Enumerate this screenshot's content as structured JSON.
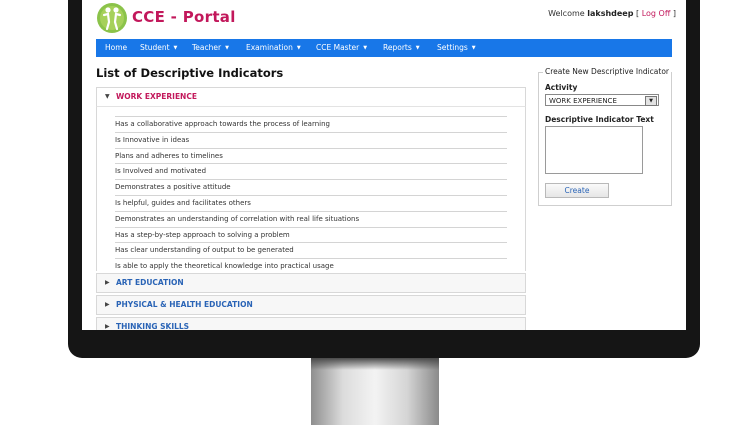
{
  "header": {
    "brand": "CCE - Portal",
    "welcome_prefix": "Welcome ",
    "username": "lakshdeep",
    "logoff_open": " [ ",
    "logoff_label": "Log Off",
    "logoff_close": " ]"
  },
  "nav": {
    "items": [
      {
        "label": "Home",
        "has_caret": false
      },
      {
        "label": "Student",
        "has_caret": true
      },
      {
        "label": "Teacher",
        "has_caret": true
      },
      {
        "label": "Examination",
        "has_caret": true
      },
      {
        "label": "CCE Master",
        "has_caret": true
      },
      {
        "label": "Reports",
        "has_caret": true
      },
      {
        "label": "Settings",
        "has_caret": true
      }
    ]
  },
  "main": {
    "title": "List of Descriptive Indicators",
    "sections": [
      {
        "title": "WORK EXPERIENCE",
        "expanded": true,
        "indicators": [
          "Has a collaborative approach towards the process of learning",
          "Is Innovative in ideas",
          "Plans and adheres to timelines",
          "Is Involved and motivated",
          "Demonstrates a positive attitude",
          "Is helpful, guides and facilitates others",
          "Demonstrates an understanding of correlation with real life situations",
          "Has a step-by-step approach to solving a problem",
          "Has clear understanding of output to be generated",
          "Is able to apply the theoretical knowledge into practical usage"
        ]
      },
      {
        "title": "ART EDUCATION",
        "expanded": false
      },
      {
        "title": "PHYSICAL & HEALTH EDUCATION",
        "expanded": false
      },
      {
        "title": "THINKING SKILLS",
        "expanded": false
      }
    ]
  },
  "side_panel": {
    "legend": "Create New Descriptive Indicator",
    "activity_label": "Activity",
    "activity_value": "WORK EXPERIENCE",
    "text_label": "Descriptive Indicator Text",
    "text_value": "",
    "create_label": "Create"
  },
  "icons": {
    "logo": "figure-logo-icon",
    "caret": "caret-down-icon",
    "expanded_arrow": "arrow-down-icon",
    "collapsed_arrow": "arrow-right-icon"
  },
  "colors": {
    "brand": "#c2185b",
    "nav": "#1877e8",
    "link": "#2a64b6"
  }
}
